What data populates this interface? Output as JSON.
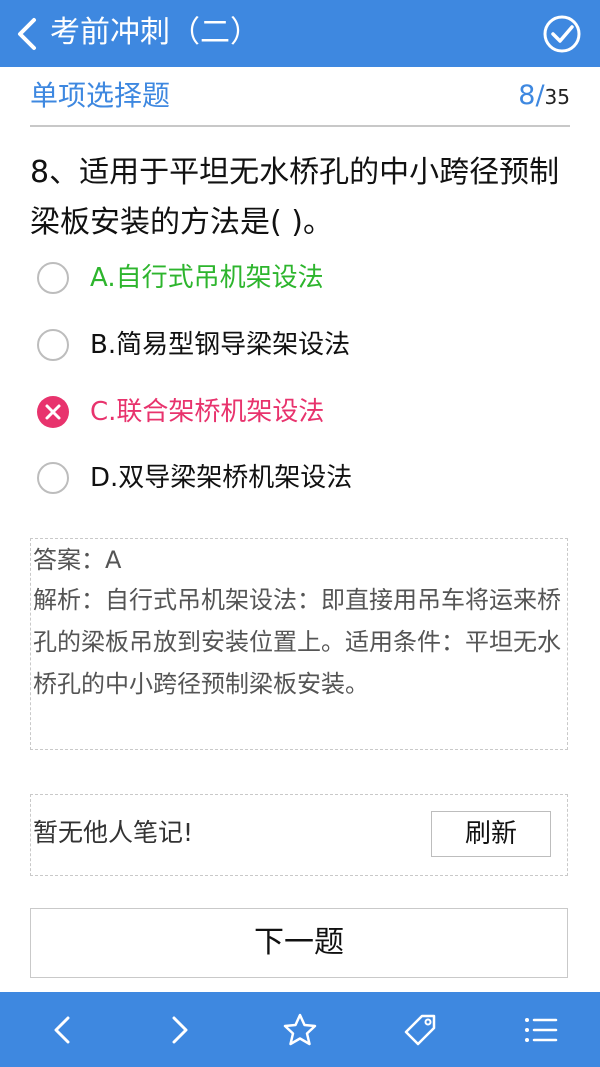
{
  "header": {
    "title": "考前冲刺（二）",
    "back_icon": "chevron-left-icon",
    "done_icon": "check-circle-icon"
  },
  "section": {
    "title": "单项选择题",
    "current": "8",
    "separator": "/",
    "total": "35"
  },
  "question": {
    "text": "8、适用于平坦无水桥孔的中小跨径预制梁板安装的方法是( )。"
  },
  "options": [
    {
      "label": "A.自行式吊机架设法",
      "state": "correct"
    },
    {
      "label": "B.简易型钢导梁架设法",
      "state": "normal"
    },
    {
      "label": "C.联合架桥机架设法",
      "state": "wrong"
    },
    {
      "label": "D.双导梁架桥机架设法",
      "state": "normal"
    }
  ],
  "answer": {
    "answer_text": "答案：A",
    "analysis_text": "解析：自行式吊机架设法：即直接用吊车将运来桥孔的梁板吊放到安装位置上。适用条件：平坦无水桥孔的中小跨径预制梁板安装。"
  },
  "notes": {
    "empty_text": "暂无他人笔记!",
    "refresh_label": "刷新"
  },
  "next_button_label": "下一题",
  "toolbar": {
    "icons": [
      "chevron-left-icon",
      "chevron-right-icon",
      "star-icon",
      "tag-icon",
      "list-icon"
    ]
  },
  "colors": {
    "primary": "#3e88e0",
    "correct": "#2db52d",
    "wrong": "#e8336d"
  }
}
